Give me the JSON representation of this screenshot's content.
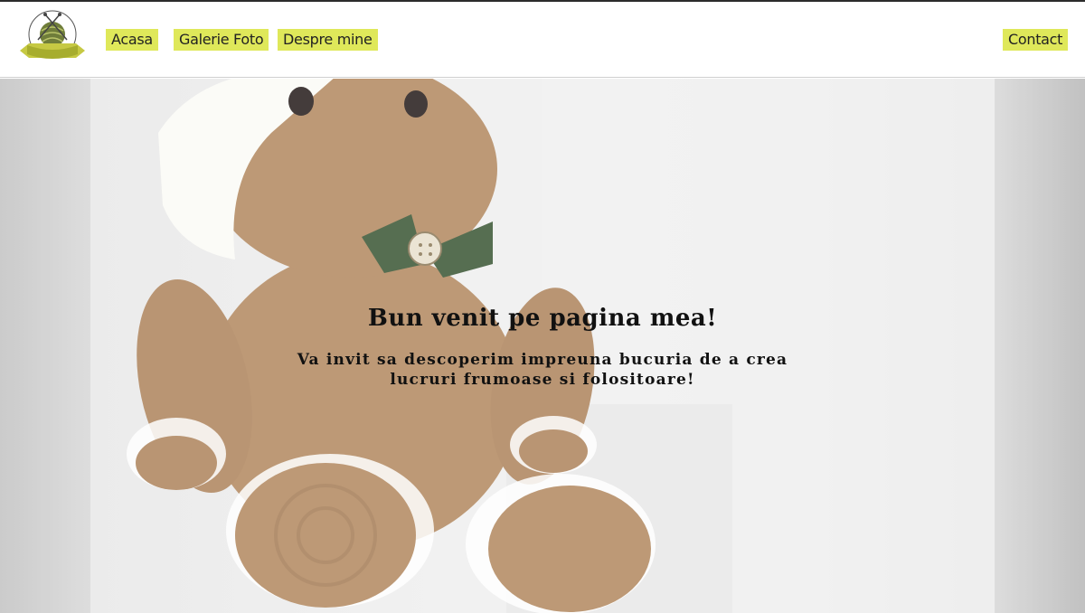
{
  "nav": {
    "items": [
      {
        "label": "Acasa"
      },
      {
        "label": "Galerie Foto"
      },
      {
        "label": "Despre mine"
      }
    ],
    "contact": {
      "label": "Contact"
    }
  },
  "logo": {
    "icon": "yarn-ball-with-needles-icon"
  },
  "hero": {
    "title": "Bun venit pe pagina mea!",
    "subtitle_line1": "Va invit sa descoperim impreuna bucuria de a crea",
    "subtitle_line2": "lucruri frumoase si folositoare!"
  },
  "colors": {
    "nav_highlight": "#dfe85a",
    "header_bg": "#ffffff",
    "toy_brown": "#b48b63",
    "bow_green": "#3f5a3a"
  }
}
